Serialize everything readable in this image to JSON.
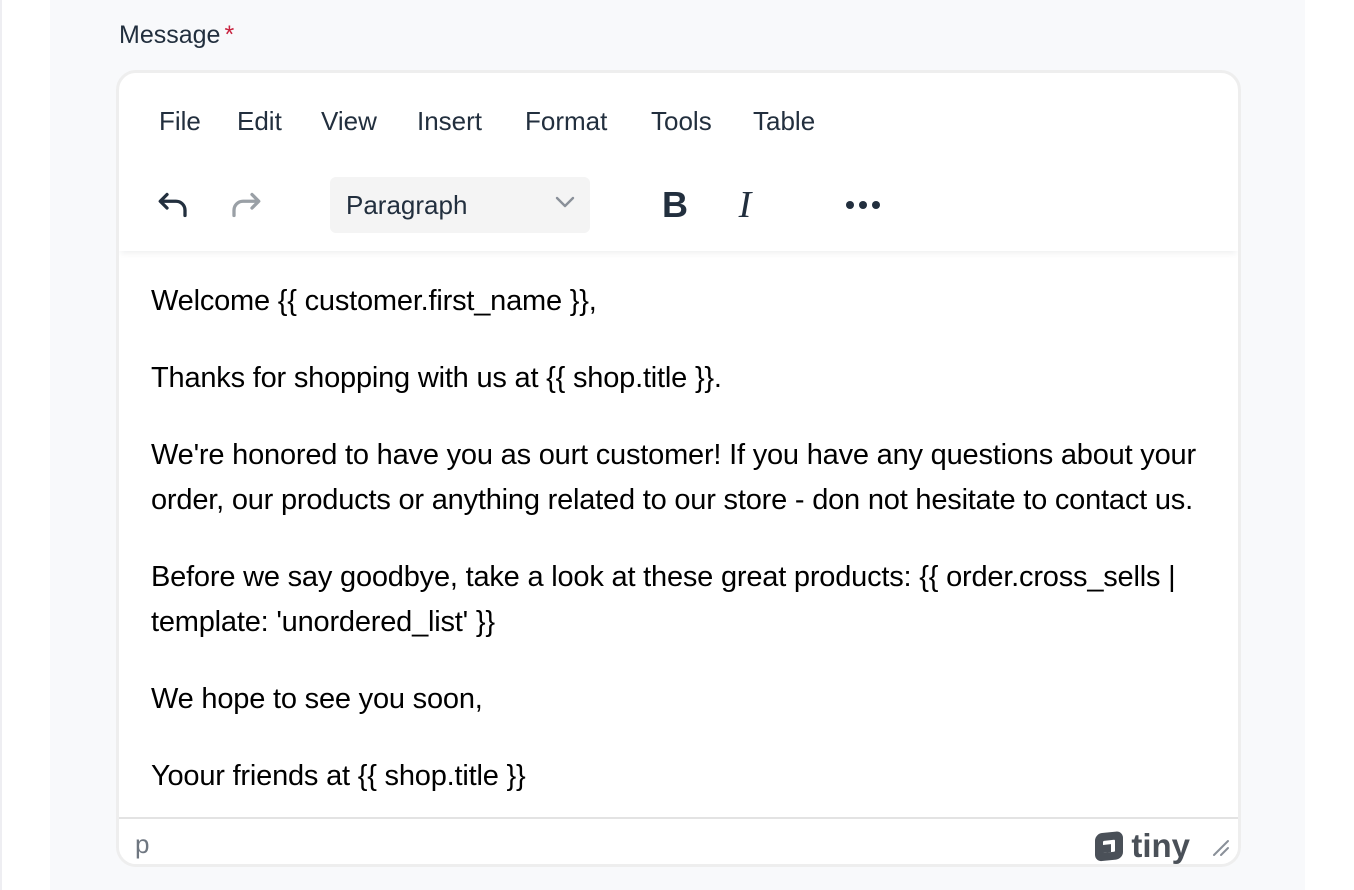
{
  "form": {
    "label": "Message",
    "required_marker": "*"
  },
  "editor": {
    "menubar": [
      "File",
      "Edit",
      "View",
      "Insert",
      "Format",
      "Tools",
      "Table"
    ],
    "toolbar": {
      "undo_icon": "undo-icon",
      "redo_icon": "redo-icon",
      "blocks_value": "Paragraph",
      "bold_label": "B",
      "italic_label": "I",
      "more_icon": "more-horizontal-icon"
    },
    "content": [
      "Welcome {{ customer.first_name }},",
      "Thanks for shopping with us at {{ shop.title }}.",
      "We're honored to have you as ourt customer! If you have any questions about your order, our products or anything related to our store - don not hesitate to contact us.",
      "Before we say goodbye, take a look at these great products: {{ order.cross_sells | template: 'unordered_list' }}",
      "We hope to see you soon,",
      "Yoour friends at {{ shop.title }}"
    ],
    "statusbar": {
      "path": "p",
      "brand": "tiny"
    }
  },
  "colors": {
    "text": "#222f3e",
    "required": "#c8233f",
    "panel_bg": "#f8f9fb",
    "border": "#eeeeee"
  }
}
